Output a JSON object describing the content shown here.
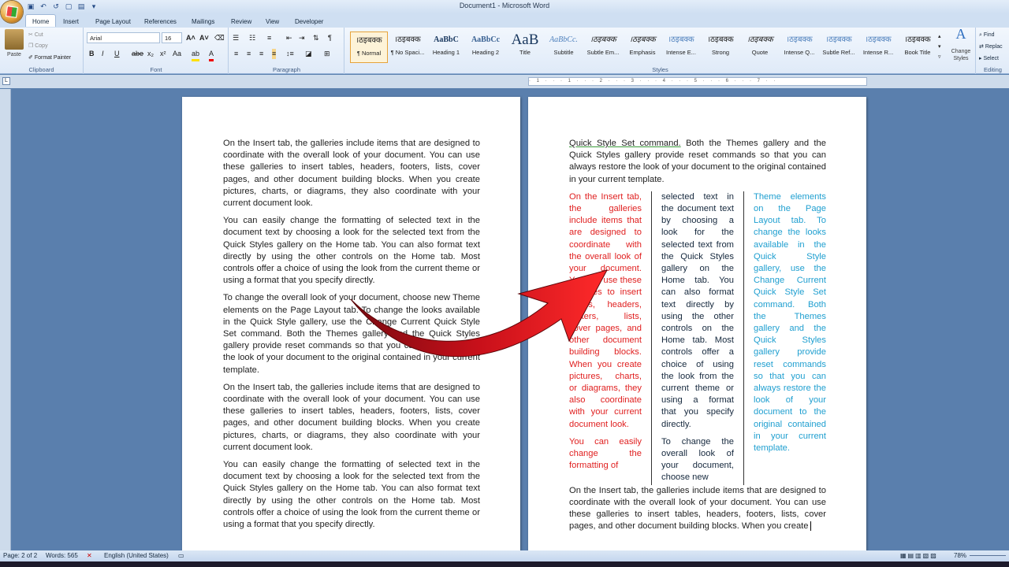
{
  "window": {
    "title": "Document1 - Microsoft Word"
  },
  "tabs": [
    "Home",
    "Insert",
    "Page Layout",
    "References",
    "Mailings",
    "Review",
    "View",
    "Developer"
  ],
  "ribbon": {
    "clipboard": {
      "paste": "Paste",
      "cut": "Cut",
      "copy": "Copy",
      "format_painter": "Format Painter",
      "label": "Clipboard"
    },
    "font": {
      "name": "Arial",
      "size": "16",
      "label": "Font"
    },
    "paragraph": {
      "label": "Paragraph"
    },
    "styles": {
      "label": "Styles",
      "items": [
        {
          "preview": "।ठइबक्क",
          "name": "¶ Normal"
        },
        {
          "preview": "।ठइबक्क",
          "name": "¶ No Spaci..."
        },
        {
          "preview": "AaBbC",
          "name": "Heading 1"
        },
        {
          "preview": "AaBbCc",
          "name": "Heading 2"
        },
        {
          "preview": "AaB",
          "name": "Title"
        },
        {
          "preview": "AaBbCc.",
          "name": "Subtitle"
        },
        {
          "preview": "।ठइबक्क",
          "name": "Subtle Em..."
        },
        {
          "preview": "।ठइबक्क",
          "name": "Emphasis"
        },
        {
          "preview": "।ठइबक्क",
          "name": "Intense E..."
        },
        {
          "preview": "।ठइबक्क",
          "name": "Strong"
        },
        {
          "preview": "।ठइबक्क",
          "name": "Quote"
        },
        {
          "preview": "।ठइबक्क",
          "name": "Intense Q..."
        },
        {
          "preview": "।ठइबक्क",
          "name": "Subtle Ref..."
        },
        {
          "preview": "।ठइबक्क",
          "name": "Intense R..."
        },
        {
          "preview": "।ठइबक्क",
          "name": "Book Title"
        }
      ],
      "change_styles": "Change Styles"
    },
    "editing": {
      "find": "Find",
      "replace": "Replac",
      "select": "Select",
      "label": "Editing"
    }
  },
  "page1": {
    "paragraphs": [
      "On the Insert tab, the galleries include items that are designed to coordinate with the overall look of your document. You can use these galleries to insert tables, headers, footers, lists, cover pages, and other document building blocks. When you create pictures, charts, or diagrams, they also coordinate with your current document look.",
      "You can easily change the formatting of selected text in the document text by choosing a look for the selected text from the Quick Styles gallery on the Home tab. You can also format text directly by using the other controls on the Home tab. Most controls offer a choice of using the look from the current theme or using a format that you specify directly.",
      "To change the overall look of your document, choose new Theme elements on the Page Layout tab. To change the looks available in the Quick Style gallery, use the Change Current Quick Style Set command. Both the Themes gallery and the Quick Styles gallery provide reset commands so that you can always restore the look of your document to the original contained in your current template.",
      "On the Insert tab, the galleries include items that are designed to coordinate with the overall look of your document. You can use these galleries to insert tables, headers, footers, lists, cover pages, and other document building blocks. When you create pictures, charts, or diagrams, they also coordinate with your current document look.",
      "You can easily change the formatting of selected text in the document text by choosing a look for the selected text from the Quick Styles gallery on the Home tab. You can also format text directly by using the other controls on the Home tab. Most controls offer a choice of using the look from the current theme or using a format that you specify directly."
    ]
  },
  "page2": {
    "top_link": "Quick Style Set command.",
    "top_rest": " Both the Themes gallery and the Quick Styles gallery provide reset commands so that you can always restore the look of your document to the original contained in your current template.",
    "col1_a": "On the Insert tab, the galleries include items that are designed to coordinate with the overall look of your document. You can use these galleries to insert tables, headers, footers, lists, cover pages, and other document building blocks. When you create pictures, charts, or diagrams, they also coordinate with your current document look.",
    "col1_b": "You can easily change the formatting of",
    "col2_a": "selected text in the document text by choosing a look for the selected text from the Quick Styles gallery on the Home tab. You can also format text directly by using the other controls on the Home tab. Most controls offer a choice of using the look from the current theme or using a format that you specify directly.",
    "col2_b": "To change the overall look of your document, choose new",
    "col3": "Theme elements on the Page Layout tab. To change the looks available in the Quick Style gallery, use the Change Current Quick Style Set command. Both the Themes gallery and the Quick Styles gallery provide reset commands so that you can always restore the look of your document to the original contained in your current template.",
    "bottom": "On the Insert tab, the galleries include items that are designed to coordinate with the overall look of your document. You can use these galleries to insert tables, headers, footers, lists, cover pages, and other document building blocks. When you create",
    "col1_color": "#e02020",
    "col3_color": "#1f9fd0"
  },
  "status": {
    "page": "Page: 2 of 2",
    "words": "Words: 565",
    "language": "English (United States)",
    "zoom": "78%"
  },
  "colors": {
    "arrow": "#c8101a"
  }
}
